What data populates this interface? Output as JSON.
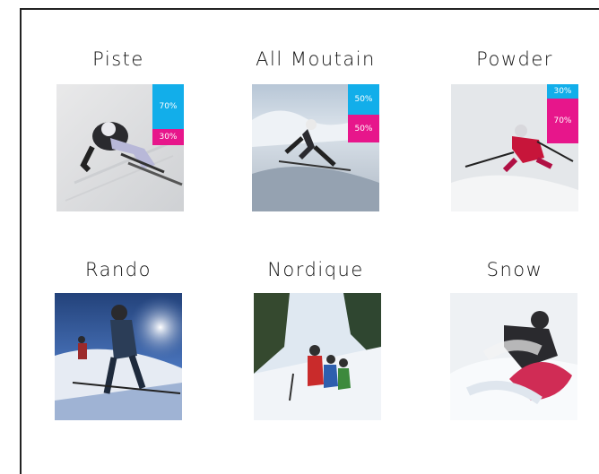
{
  "categories": [
    {
      "id": "piste",
      "label": "Piste",
      "badges": [
        {
          "pct": "70%",
          "color": "#12aeea",
          "frac": 0.7
        },
        {
          "pct": "30%",
          "color": "#e7168b",
          "frac": 0.3
        }
      ]
    },
    {
      "id": "all-moutain",
      "label": "All Moutain",
      "badges": [
        {
          "pct": "50%",
          "color": "#12aeea",
          "frac": 0.5
        },
        {
          "pct": "50%",
          "color": "#e7168b",
          "frac": 0.5
        }
      ]
    },
    {
      "id": "powder",
      "label": "Powder",
      "badges": [
        {
          "pct": "30%",
          "color": "#12aeea",
          "frac": 0.3
        },
        {
          "pct": "70%",
          "color": "#e7168b",
          "frac": 0.7
        }
      ]
    },
    {
      "id": "rando",
      "label": "Rando",
      "badges": []
    },
    {
      "id": "nordique",
      "label": "Nordique",
      "badges": []
    },
    {
      "id": "snow",
      "label": "Snow",
      "badges": []
    }
  ]
}
